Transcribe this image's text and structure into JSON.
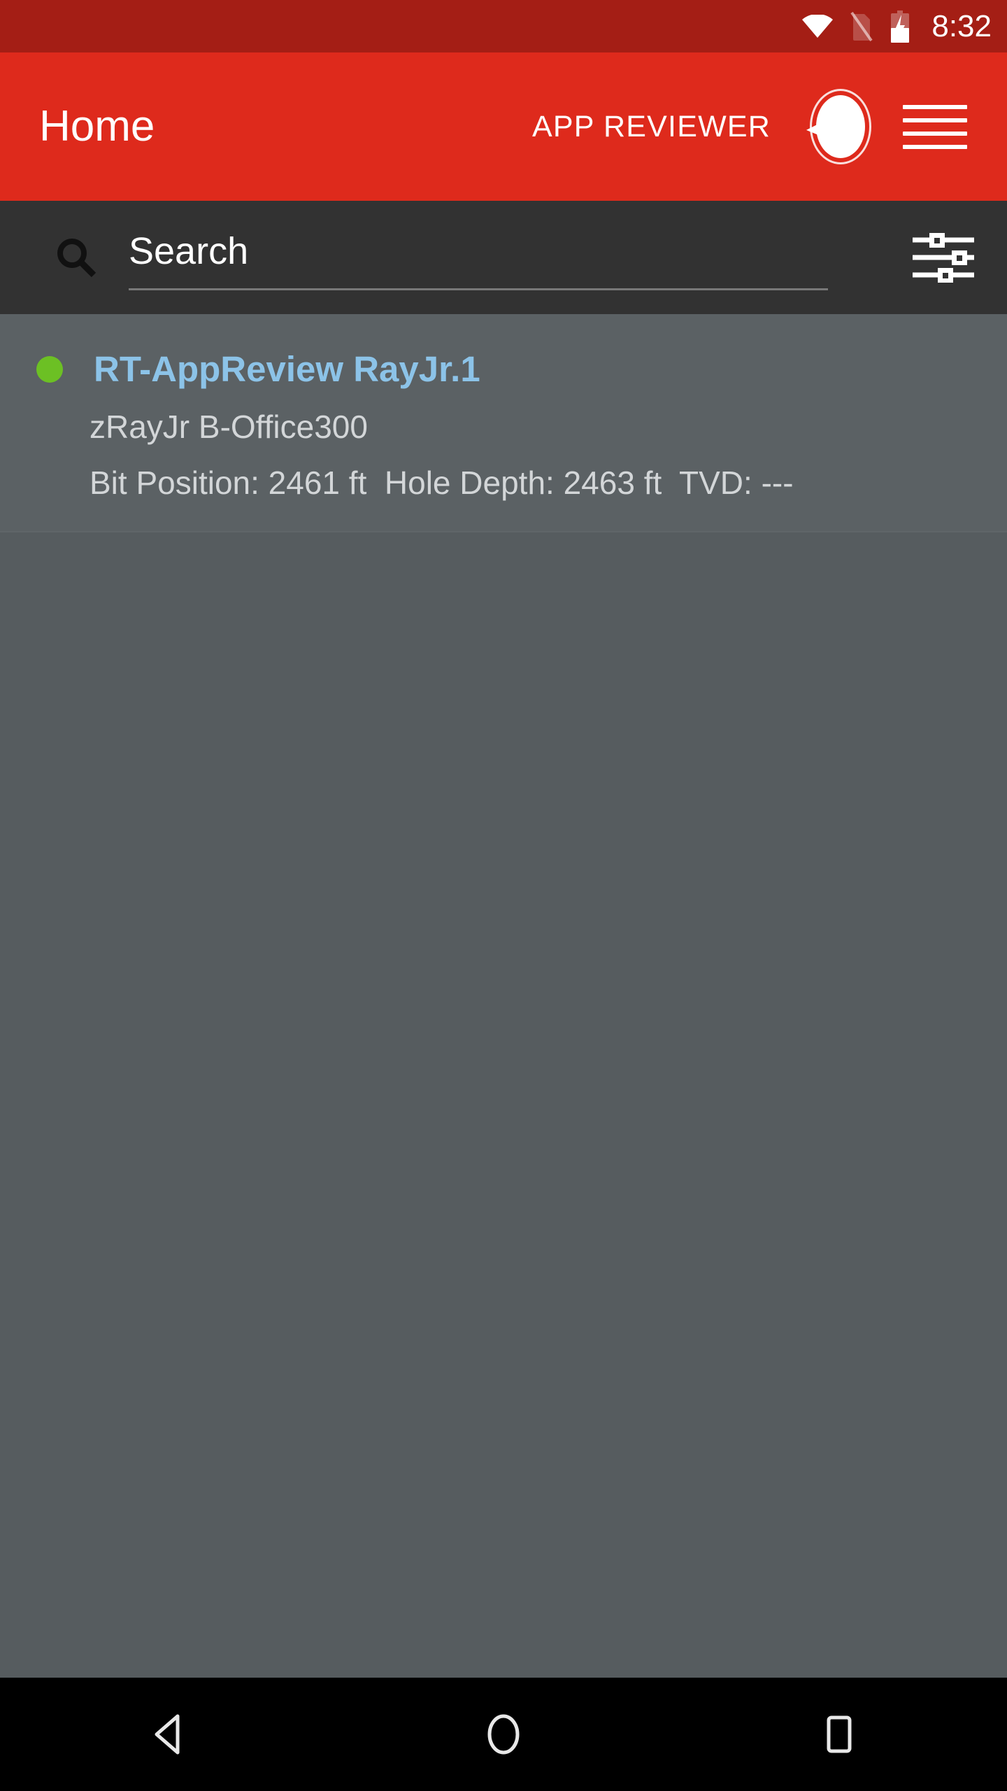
{
  "status_bar": {
    "time": "8:32",
    "icons": [
      "wifi-icon",
      "sim-card-off-icon",
      "battery-charging-icon"
    ],
    "background_color": "#a41e15"
  },
  "app_bar": {
    "title": "Home",
    "subtitle": "APP REVIEWER",
    "logo_icon": "app-logo-icon",
    "menu_icon": "hamburger-menu-icon",
    "background_color": "#de2a1c",
    "text_color": "#ffffff"
  },
  "search": {
    "placeholder": "Search",
    "value": "",
    "search_icon": "search-icon",
    "filter_icon": "filter-sliders-icon",
    "background_color": "#323232"
  },
  "list": {
    "background_color": "#565c5f",
    "items": [
      {
        "status_color": "#6cc024",
        "status_icon": "status-dot-active",
        "title": "RT-AppReview RayJr.1",
        "title_color": "#8cc3e8",
        "subtitle": "zRayJr B-Office300",
        "meta": "Bit Position: 2461 ft  Hole Depth: 2463 ft  TVD: ---",
        "bit_position": "2461 ft",
        "hole_depth": "2463 ft",
        "tvd": "---"
      }
    ]
  },
  "nav_bar": {
    "background_color": "#000000",
    "buttons": [
      {
        "name": "back-button",
        "icon": "back-triangle-icon"
      },
      {
        "name": "home-button",
        "icon": "home-circle-icon"
      },
      {
        "name": "recents-button",
        "icon": "recents-square-icon"
      }
    ]
  }
}
